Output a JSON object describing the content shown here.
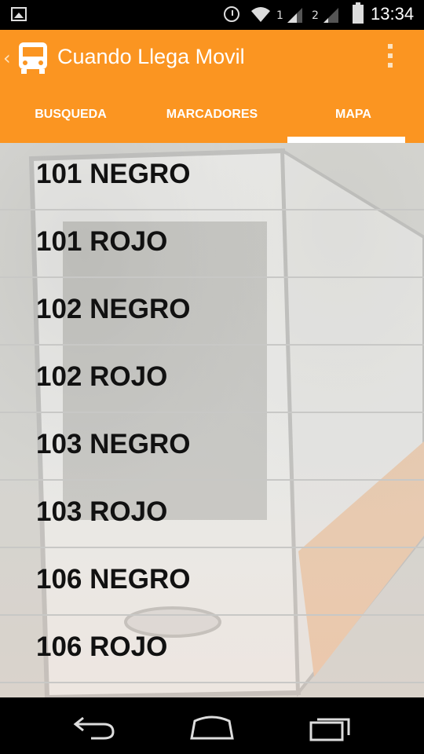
{
  "status_bar": {
    "time": "13:34",
    "sim1_label": "1",
    "sim2_label": "2",
    "icons": [
      "picture-icon",
      "alarm-icon",
      "wifi-icon",
      "signal-icon",
      "battery-icon"
    ]
  },
  "action_bar": {
    "title": "Cuando Llega Movil",
    "accent_color": "#fb9521",
    "icons": [
      "back-chevron-icon",
      "bus-icon",
      "overflow-menu-icon"
    ]
  },
  "tabs": [
    {
      "label": "BUSQUEDA",
      "active": false
    },
    {
      "label": "MARCADORES",
      "active": false
    },
    {
      "label": "MAPA",
      "active": true
    }
  ],
  "routes": [
    "101 NEGRO",
    "101 ROJO",
    "102 NEGRO",
    "102 ROJO",
    "103 NEGRO",
    "103 ROJO",
    "106 NEGRO",
    "106 ROJO"
  ],
  "nav_bar": {
    "icons": [
      "back-icon",
      "home-icon",
      "recents-icon"
    ]
  }
}
